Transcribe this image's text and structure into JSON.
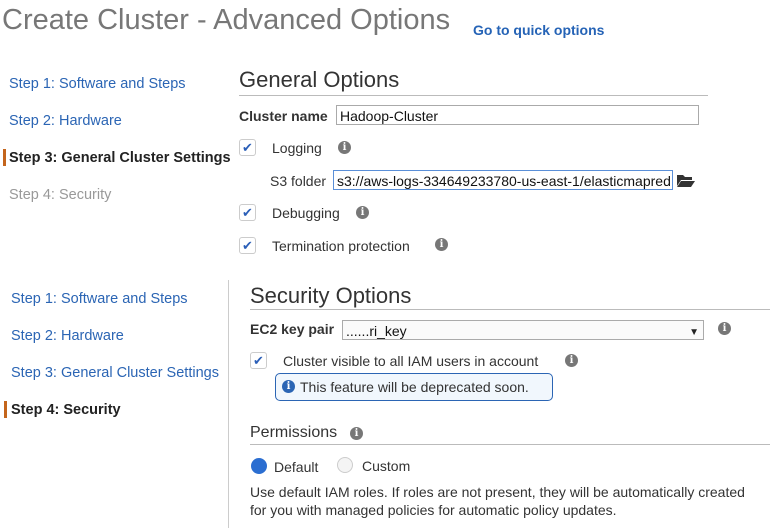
{
  "header": {
    "title": "Create Cluster - Advanced Options",
    "quick_link": "Go to quick options"
  },
  "nav_top": [
    "Step 1: Software and Steps",
    "Step 2: Hardware",
    "Step 3: General Cluster Settings",
    "Step 4: Security"
  ],
  "nav_bottom": [
    "Step 1: Software and Steps",
    "Step 2: Hardware",
    "Step 3: General Cluster Settings",
    "Step 4: Security"
  ],
  "general": {
    "heading": "General Options",
    "cluster_name_label": "Cluster name",
    "cluster_name": "Hadoop-Cluster",
    "logging": "Logging",
    "s3_label": "S3 folder",
    "s3_value": "s3://aws-logs-334649233780-us-east-1/elasticmapred",
    "debugging": "Debugging",
    "termination": "Termination protection"
  },
  "security": {
    "heading": "Security Options",
    "key_pair_label": "EC2 key pair",
    "key_pair_value": "......ri_key",
    "visible_label": "Cluster visible to all IAM users in account",
    "notice": "This feature will be deprecated soon.",
    "permissions": "Permissions",
    "default": "Default",
    "custom": "Custom",
    "desc1": "Use default IAM roles. If roles are not present, they will be automatically created",
    "desc2": "for you with managed policies for automatic policy updates."
  },
  "icons": {
    "info": "i",
    "check": "✔",
    "arrow": "▼"
  }
}
